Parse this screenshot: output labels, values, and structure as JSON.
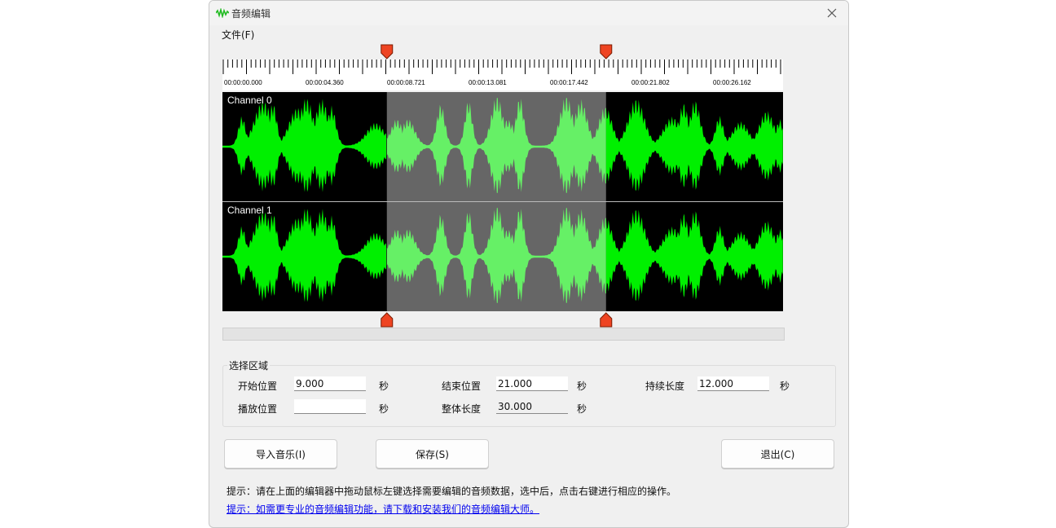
{
  "window": {
    "title": "音频编辑"
  },
  "menu": {
    "file": "文件(F)"
  },
  "timeline": {
    "labels": [
      "00:00:00.000",
      "00:00:04.360",
      "00:00:08.721",
      "00:00:13.081",
      "00:00:17.442",
      "00:00:21.802",
      "00:00:26.162"
    ],
    "total_seconds": 30.0,
    "selection_start_seconds": 9.0,
    "selection_end_seconds": 21.0
  },
  "channels": [
    "Channel 0",
    "Channel 1"
  ],
  "colors": {
    "waveform": "#00f000",
    "waveform_selected": "#66f066",
    "selection": "#666666",
    "marker": "#ee4422",
    "link": "#0000ee"
  },
  "selection": {
    "title": "选择区域",
    "start_label": "开始位置",
    "start_value": "9.000",
    "end_label": "结束位置",
    "end_value": "21.000",
    "duration_label": "持续长度",
    "duration_value": "12.000",
    "play_label": "播放位置",
    "play_value": "",
    "total_label": "整体长度",
    "total_value": "30.000",
    "unit": "秒"
  },
  "buttons": {
    "import": "导入音乐(I)",
    "save": "保存(S)",
    "exit": "退出(C)"
  },
  "hint": "提示：请在上面的编辑器中拖动鼠标左键选择需要编辑的音频数据，选中后，点击右键进行相应的操作。",
  "link": "提示：如需更专业的音频编辑功能，请下载和安装我们的音频编辑大师。"
}
